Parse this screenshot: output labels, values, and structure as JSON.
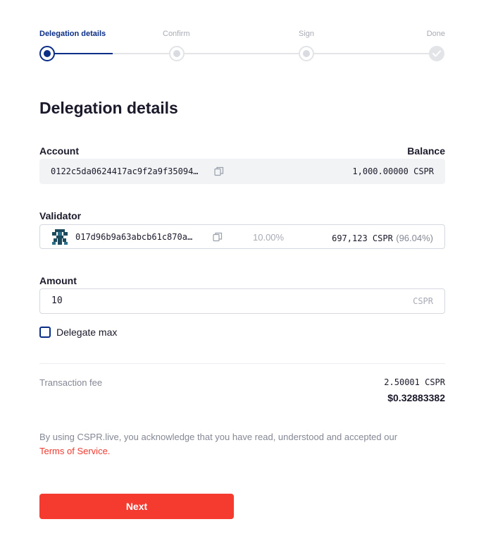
{
  "stepper": {
    "steps": [
      {
        "label": "Delegation details",
        "state": "active"
      },
      {
        "label": "Confirm",
        "state": "pending"
      },
      {
        "label": "Sign",
        "state": "pending"
      },
      {
        "label": "Done",
        "state": "done"
      }
    ]
  },
  "page_title": "Delegation details",
  "account": {
    "label": "Account",
    "balance_label": "Balance",
    "address": "0122c5da0624417ac9f2a9f35094…",
    "balance": "1,000.00000 CSPR"
  },
  "validator": {
    "label": "Validator",
    "address": "017d96b9a63abcb61c870a…",
    "fee_percent": "10.00%",
    "stake": "697,123 CSPR",
    "stake_share": "(96.04%)"
  },
  "amount": {
    "label": "Amount",
    "value": "10",
    "unit": "CSPR"
  },
  "delegate_max": {
    "label": "Delegate max",
    "checked": false
  },
  "fee": {
    "label": "Transaction fee",
    "cspr": "2.50001 CSPR",
    "usd": "$0.32883382"
  },
  "terms": {
    "text": "By using CSPR.live, you acknowledge that you have read, understood and accepted our",
    "link": "Terms of Service."
  },
  "next_button": "Next",
  "colors": {
    "primary": "#0a2e87",
    "accent": "#f53b30",
    "link": "#ef3a2f"
  }
}
